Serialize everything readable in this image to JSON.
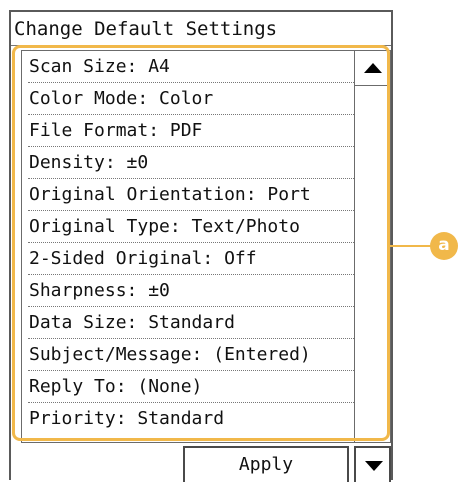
{
  "window": {
    "title": "Change Default Settings"
  },
  "settings": {
    "items": [
      {
        "label": "Scan Size: A4"
      },
      {
        "label": "Color Mode: Color"
      },
      {
        "label": "File Format: PDF"
      },
      {
        "label": "Density: ±0"
      },
      {
        "label": "Original Orientation: Port"
      },
      {
        "label": "Original Type: Text/Photo"
      },
      {
        "label": "2-Sided Original: Off"
      },
      {
        "label": "Sharpness: ±0"
      },
      {
        "label": "Data Size: Standard"
      },
      {
        "label": "Subject/Message: (Entered)"
      },
      {
        "label": "Reply To: (None)"
      },
      {
        "label": "Priority: Standard"
      }
    ]
  },
  "buttons": {
    "apply_label": "Apply"
  },
  "icons": {
    "scroll_up": "triangle-up-icon",
    "scroll_down": "triangle-down-icon"
  },
  "annotation": {
    "label": "a",
    "color": "#f1b84a"
  }
}
